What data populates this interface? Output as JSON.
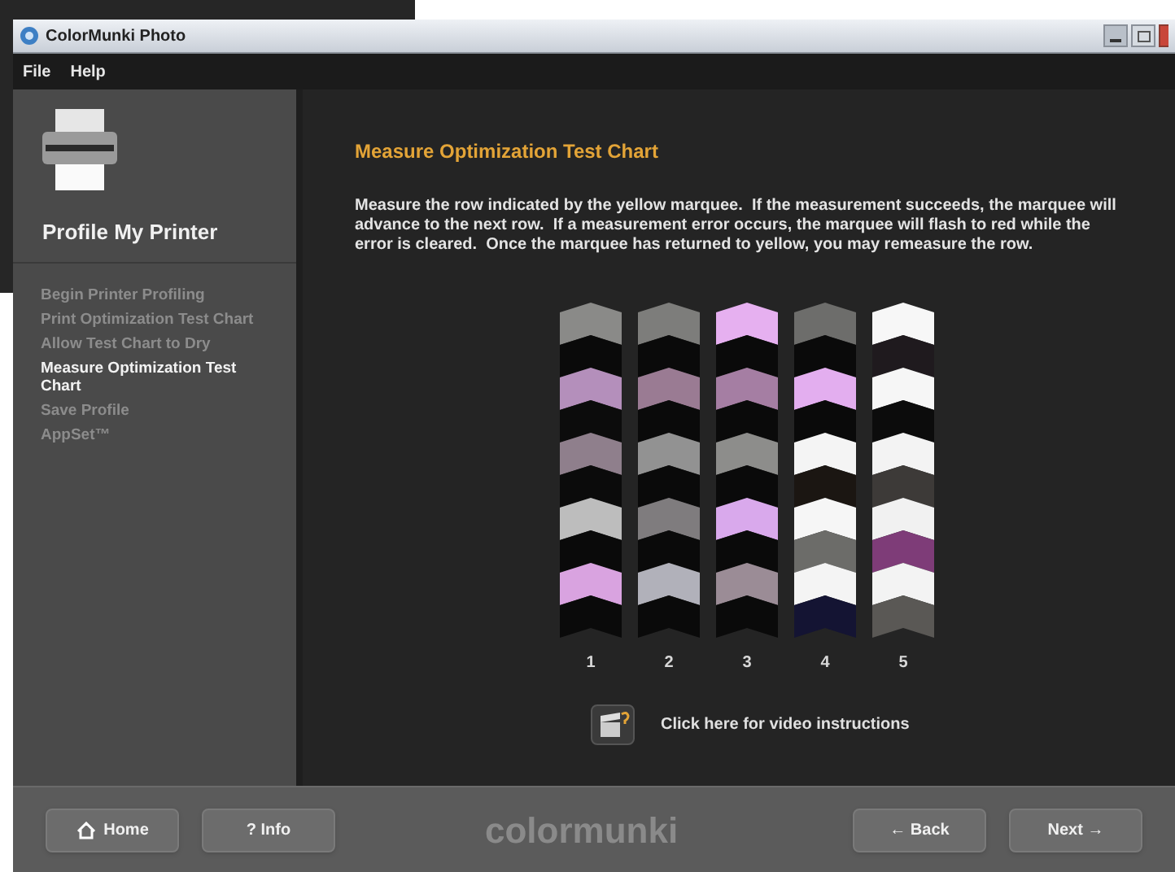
{
  "window": {
    "title": "ColorMunki Photo"
  },
  "menu": [
    "File",
    "Help"
  ],
  "sidebar": {
    "heading": "Profile My Printer",
    "steps": [
      {
        "label": "Begin Printer Profiling",
        "selected": false
      },
      {
        "label": "Print Optimization Test Chart",
        "selected": false
      },
      {
        "label": "Allow Test Chart to Dry",
        "selected": false
      },
      {
        "label": "Measure Optimization Test Chart",
        "selected": true
      },
      {
        "label": "Save Profile",
        "selected": false
      },
      {
        "label": "AppSet™",
        "selected": false
      }
    ]
  },
  "content": {
    "title": "Measure Optimization Test Chart",
    "instructions": "Measure the row indicated by the yellow marquee.  If the measurement succeeds, the marquee will advance to the next row.  If a measurement error occurs, the marquee will flash to red while the error is cleared.  Once the marquee has returned to yellow, you may remeasure the row.",
    "columns": [
      {
        "label": "1",
        "swatches": [
          {
            "color": "#8a8a88"
          },
          {
            "color": "#0a0a0a"
          },
          {
            "color": "#b48fbb"
          },
          {
            "color": "#0c0c0c"
          },
          {
            "color": "#8f7f8c"
          },
          {
            "color": "#0b0b0b"
          },
          {
            "color": "#bdbdbd"
          },
          {
            "color": "#0a0a0a"
          },
          {
            "color": "#d9a3e0"
          },
          {
            "color": "#0a0a0a"
          }
        ]
      },
      {
        "label": "2",
        "swatches": [
          {
            "color": "#7d7d7b"
          },
          {
            "color": "#0a0a0a"
          },
          {
            "color": "#9a7b93"
          },
          {
            "color": "#0a0a0a"
          },
          {
            "color": "#929292"
          },
          {
            "color": "#0a0a0a"
          },
          {
            "color": "#7f7c7e"
          },
          {
            "color": "#0a0a0a"
          },
          {
            "color": "#b1b1ba"
          },
          {
            "color": "#0a0a0a"
          }
        ]
      },
      {
        "label": "3",
        "swatches": [
          {
            "color": "#e6b0f0"
          },
          {
            "color": "#0a0a0a"
          },
          {
            "color": "#a57ea3"
          },
          {
            "color": "#0a0a0a"
          },
          {
            "color": "#8d8d8b"
          },
          {
            "color": "#0a0a0a"
          },
          {
            "color": "#d9a9ec"
          },
          {
            "color": "#0a0a0a"
          },
          {
            "color": "#9b8c96"
          },
          {
            "color": "#0a0a0a"
          }
        ]
      },
      {
        "label": "4",
        "swatches": [
          {
            "color": "#6d6d6b"
          },
          {
            "color": "#0a0a0a"
          },
          {
            "color": "#e3aeef"
          },
          {
            "color": "#0a0a0a"
          },
          {
            "color": "#f4f4f4"
          },
          {
            "color": "#1b1612"
          },
          {
            "color": "#f6f6f6"
          },
          {
            "color": "#6c6c69"
          },
          {
            "color": "#f4f4f4"
          },
          {
            "color": "#141433"
          }
        ]
      },
      {
        "label": "5",
        "swatches": [
          {
            "color": "#f7f7f7"
          },
          {
            "color": "#1f1a1e"
          },
          {
            "color": "#f6f6f6"
          },
          {
            "color": "#0c0c0c"
          },
          {
            "color": "#f3f3f3"
          },
          {
            "color": "#3d3a38"
          },
          {
            "color": "#f1f1f1"
          },
          {
            "color": "#7e3c78"
          },
          {
            "color": "#f3f3f3"
          },
          {
            "color": "#5a5855"
          }
        ]
      }
    ],
    "video_link": "Click here for video instructions"
  },
  "footer": {
    "left_buttons": [
      {
        "kind": "home",
        "label": "Home"
      },
      {
        "kind": "info",
        "label": "? Info"
      }
    ],
    "logo": "colormunki",
    "right_buttons": [
      {
        "label": "← Back"
      },
      {
        "label": "Next →"
      }
    ]
  }
}
